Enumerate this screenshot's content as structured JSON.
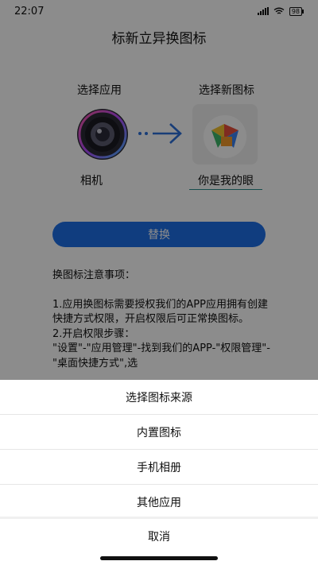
{
  "status_bar": {
    "time": "22:07",
    "battery": "98"
  },
  "page": {
    "title": "标新立异换图标"
  },
  "selection": {
    "choose_app_label": "选择应用",
    "choose_icon_label": "选择新图标",
    "app_name": "相机",
    "new_icon_name": "你是我的眼"
  },
  "actions": {
    "replace_label": "替换"
  },
  "notes": {
    "heading": "换图标注意事项：",
    "item1": "1.应用换图标需要授权我们的APP应用拥有创建快捷方式权限，开启权限后可正常换图标。",
    "item2_title": "2.开启权限步骤：",
    "item2_body": "\"设置\"-\"应用管理\"-找到我们的APP-\"权限管理\"-\"桌面快捷方式\",选"
  },
  "sheet": {
    "title": "选择图标来源",
    "options": [
      "内置图标",
      "手机相册",
      "其他应用"
    ],
    "cancel": "取消"
  },
  "colors": {
    "primary": "#1e6fe8",
    "overlay": "rgba(0,0,0,0.45)"
  }
}
